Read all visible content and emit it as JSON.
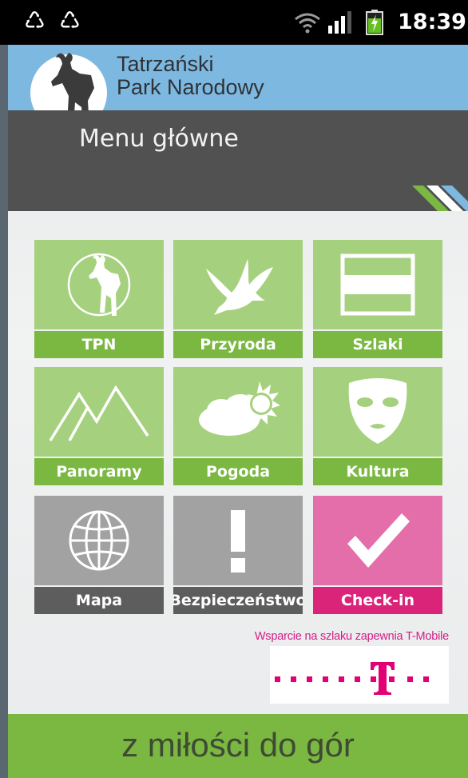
{
  "status_bar": {
    "time": "18:39",
    "notification_icons": [
      "recycle-icon",
      "recycle-icon"
    ],
    "indicators": [
      "wifi-icon",
      "signal-icon",
      "battery-charging-icon"
    ]
  },
  "header": {
    "brand_line1": "Tatrzański",
    "brand_line2": "Park Narodowy",
    "logo_icon": "chamois-logo-icon",
    "colors": {
      "top_band": "#7db8e0",
      "title_band": "#515151"
    }
  },
  "page": {
    "title": "Menu główne"
  },
  "tiles": [
    {
      "label": "TPN",
      "icon": "chamois-circle-icon",
      "color": "green"
    },
    {
      "label": "Przyroda",
      "icon": "bird-icon",
      "color": "green"
    },
    {
      "label": "Szlaki",
      "icon": "trail-sign-icon",
      "color": "green"
    },
    {
      "label": "Panoramy",
      "icon": "mountains-icon",
      "color": "green"
    },
    {
      "label": "Pogoda",
      "icon": "cloud-sun-icon",
      "color": "green"
    },
    {
      "label": "Kultura",
      "icon": "mask-icon",
      "color": "green"
    },
    {
      "label": "Mapa",
      "icon": "globe-icon",
      "color": "gray"
    },
    {
      "label": "Bezpieczeństwo",
      "icon": "exclamation-icon",
      "color": "gray"
    },
    {
      "label": "Check-in",
      "icon": "checkmark-icon",
      "color": "pink"
    }
  ],
  "colors": {
    "green_icon": "#a5d07d",
    "green_label": "#7ab841",
    "gray_icon": "#a2a2a2",
    "gray_label": "#5d5d5d",
    "pink_icon": "#e36ea9",
    "pink_label": "#d9247a"
  },
  "sponsor": {
    "text": "Wsparcie na szlaku zapewnia T-Mobile",
    "logo": "t-mobile-logo-icon",
    "brand_color": "#e20074"
  },
  "footer": {
    "slogan": "z miłości do gór"
  }
}
